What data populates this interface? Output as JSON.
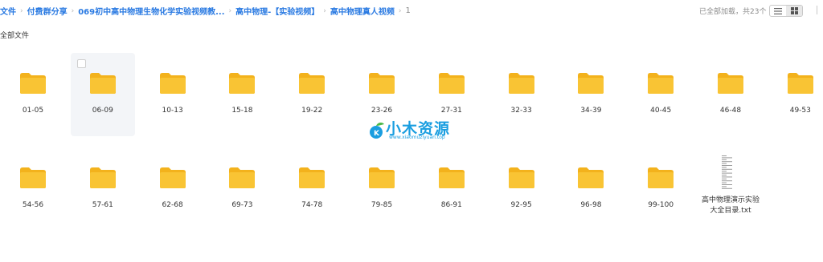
{
  "breadcrumb": [
    "文件",
    "付费群分享",
    "069初中高中物理生物化学实验视频教...",
    "高中物理-【实验视频】",
    "高中物理真人视频",
    "1"
  ],
  "status": {
    "loaded_text": "已全部加载，共23个"
  },
  "view": {
    "mode": "grid"
  },
  "section": {
    "title": "全部文件"
  },
  "files": [
    {
      "name": "01-05",
      "type": "folder"
    },
    {
      "name": "06-09",
      "type": "folder"
    },
    {
      "name": "10-13",
      "type": "folder"
    },
    {
      "name": "15-18",
      "type": "folder"
    },
    {
      "name": "19-22",
      "type": "folder"
    },
    {
      "name": "23-26",
      "type": "folder"
    },
    {
      "name": "27-31",
      "type": "folder"
    },
    {
      "name": "32-33",
      "type": "folder"
    },
    {
      "name": "34-39",
      "type": "folder"
    },
    {
      "name": "40-45",
      "type": "folder"
    },
    {
      "name": "46-48",
      "type": "folder"
    },
    {
      "name": "49-53",
      "type": "folder"
    },
    {
      "name": "54-56",
      "type": "folder"
    },
    {
      "name": "57-61",
      "type": "folder"
    },
    {
      "name": "62-68",
      "type": "folder"
    },
    {
      "name": "69-73",
      "type": "folder"
    },
    {
      "name": "74-78",
      "type": "folder"
    },
    {
      "name": "79-85",
      "type": "folder"
    },
    {
      "name": "86-91",
      "type": "folder"
    },
    {
      "name": "92-95",
      "type": "folder"
    },
    {
      "name": "96-98",
      "type": "folder"
    },
    {
      "name": "99-100",
      "type": "folder"
    },
    {
      "name": "高中物理演示实验大全目录.txt",
      "type": "txt"
    }
  ],
  "watermark": {
    "text": "小木资源",
    "url": "www.xiaomuziyuan.top"
  },
  "colors": {
    "link": "#2a7ae2",
    "folder": "#f9c434",
    "folder_back": "#f3b21c",
    "watermark": "#1a9ee0"
  }
}
